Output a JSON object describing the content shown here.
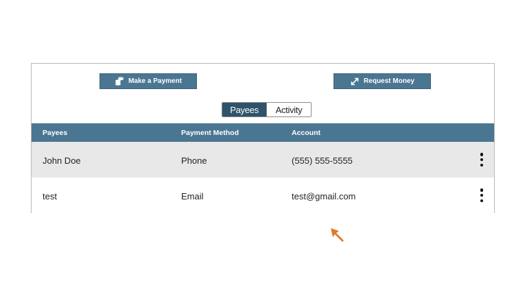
{
  "actions": {
    "make_payment_label": "Make a Payment",
    "request_money_label": "Request Money"
  },
  "tabs": {
    "payees": "Payees",
    "activity": "Activity",
    "active": "Payees"
  },
  "table": {
    "headers": [
      "Payees",
      "Payment Method",
      "Account"
    ],
    "rows": [
      {
        "payee": "John Doe",
        "method": "Phone",
        "account": "(555) 555-5555"
      },
      {
        "payee": "test",
        "method": "Email",
        "account": "test@gmail.com"
      }
    ]
  },
  "colors": {
    "accent": "#4a7692",
    "accent_dark": "#2f536a",
    "row_alt": "#e8e8e8",
    "cursor": "#e07b2a"
  },
  "icons": {
    "payment": "coins-icon",
    "request": "arrows-diagonal-icon",
    "row_menu": "more-vertical-icon",
    "pointer": "cursor-arrow-icon"
  }
}
